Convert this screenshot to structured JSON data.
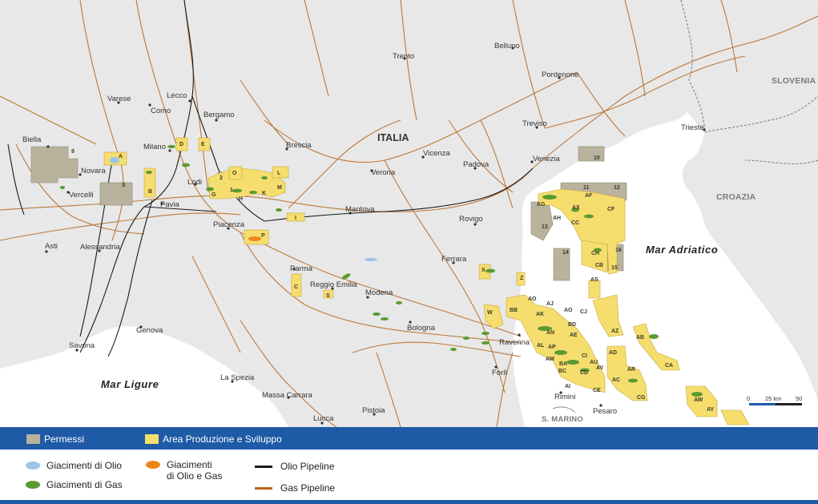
{
  "map": {
    "seas": {
      "ligure": "Mar Ligure",
      "adriatico": "Mar Adriatico"
    },
    "country": "ITALIA",
    "neighbors": {
      "slovenia": "SLOVENIA",
      "croazia": "CROAZIA",
      "san_marino": "S. MARINO"
    },
    "cities": {
      "biella": "Biella",
      "novara": "Novara",
      "vercelli": "Vercelli",
      "varese": "Varese",
      "como": "Como",
      "lecco": "Lecco",
      "bergamo": "Bergamo",
      "milano": "Milano",
      "lodi": "Lodi",
      "pavia": "Pavia",
      "brescia": "Brescia",
      "trento": "Trento",
      "belluno": "Belluno",
      "pordenone": "Pordenone",
      "treviso": "Treviso",
      "trieste": "Trieste",
      "venezia": "Venezia",
      "padova": "Padova",
      "vicenza": "Vicenza",
      "verona": "Verona",
      "mantova": "Mantova",
      "rovigo": "Rovigo",
      "ferrara": "Ferrara",
      "piacenza": "Piacenza",
      "parma": "Parma",
      "reggio_emilia": "Reggio Emilia",
      "modena": "Modena",
      "bologna": "Bologna",
      "ravenna": "Ravenna",
      "forli": "Forlì",
      "rimini": "Rimini",
      "pesaro": "Pesaro",
      "asti": "Asti",
      "alessandria": "Alessandria",
      "genova": "Genova",
      "savona": "Savona",
      "la_spezia": "La Spezia",
      "massa_carrara": "Massa Carrara",
      "lucca": "Lucca",
      "pistoia": "Pistoia"
    },
    "blocks": {
      "b9": "9",
      "bS": "S",
      "bA": "A",
      "bB": "B",
      "bD": "D",
      "bE": "E",
      "b2": "2",
      "bO": "O",
      "bL": "L",
      "bM": "M",
      "bG": "G",
      "b1": "1",
      "bH": "H",
      "bK": "K",
      "bI": "I",
      "bP": "P",
      "bC": "C",
      "bS2": "S",
      "b10": "10",
      "b11": "11",
      "b12": "12",
      "bAG": "AG",
      "bAF": "AF",
      "bAX": "AX",
      "bCF": "CF",
      "bAH": "AH",
      "bCC": "CC",
      "b13": "13",
      "b14": "14",
      "bCH": "CH",
      "b16": "16",
      "bCB": "CB",
      "b15": "15",
      "bX": "X",
      "bZ": "Z",
      "bAS": "AS",
      "bAO": "AO",
      "bBB": "BB",
      "bAJ": "AJ",
      "bAO2": "AO",
      "bCJ": "CJ",
      "bW": "W",
      "bAK": "AK",
      "bBD": "BD",
      "bAN": "AN",
      "bAE": "AE",
      "bAZ": "AZ",
      "bAB": "AB",
      "bAL": "AL",
      "bAP": "AP",
      "bCI": "CI",
      "bAD": "AD",
      "bAM": "AM",
      "bBA": "BA",
      "bAU": "AU",
      "bAV": "AV",
      "bBC": "BC",
      "bCD": "CD",
      "bAR": "AR",
      "bCA": "CA",
      "bAC": "AC",
      "bAI": "AI",
      "bCE": "CE",
      "bCG": "CG",
      "bAW": "AW",
      "bAY": "AY"
    },
    "scale": {
      "zero": "0",
      "mid": "25 km",
      "end": "50"
    },
    "colors": {
      "land": "#e8e8e8",
      "sea": "#ffffff",
      "permessi": "#b9b29c",
      "produzione": "#f6de6e",
      "gas_field": "#5b9a31",
      "oil_field": "#9cc4e8",
      "oil_gas_field": "#ef8418",
      "oil_pipeline": "#1a1a1a",
      "gas_pipeline": "#b5651d"
    }
  },
  "legend": {
    "permessi": "Permessi",
    "area_produzione": "Area Produzione e Sviluppo",
    "giacimenti_olio": "Giacimenti di Olio",
    "giacimenti_gas": "Giacimenti di Gas",
    "giacimenti_olio_gas_line1": "Giacimenti",
    "giacimenti_olio_gas_line2": "di Olio e Gas",
    "olio_pipeline": "Olio Pipeline",
    "gas_pipeline": "Gas Pipeline"
  }
}
